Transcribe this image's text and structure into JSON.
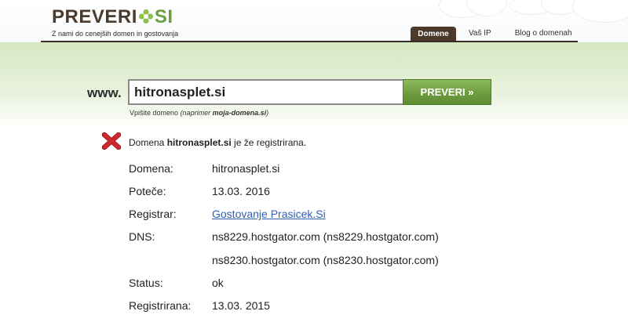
{
  "logo": {
    "prefix": "PREVERI",
    "suffix": "SI",
    "tagline": "Z nami do cenejših domen in gostovanja"
  },
  "nav": {
    "items": [
      {
        "label": "Domene",
        "active": true
      },
      {
        "label": "Vaš IP",
        "active": false
      },
      {
        "label": "Blog o domenah",
        "active": false
      }
    ]
  },
  "search": {
    "prefix": "www.",
    "value": "hitronasplet.si",
    "button_label": "PREVERI »",
    "hint_text": "Vpišite domeno",
    "hint_example_prefix": "(naprimer ",
    "hint_example": "moja-domena.si",
    "hint_example_suffix": ")"
  },
  "result": {
    "icon": "red-x-icon",
    "msg_prefix": "Domena ",
    "msg_domain": "hitronasplet.si",
    "msg_suffix": " je že registrirana.",
    "rows": [
      {
        "label": "Domena:",
        "value": "hitronasplet.si"
      },
      {
        "label": "Poteče:",
        "value": "13.03. 2016"
      },
      {
        "label": "Registrar:",
        "value": "Gostovanje Prasicek.Si"
      },
      {
        "label": "DNS:",
        "value": "ns8229.hostgator.com (ns8229.hostgator.com)"
      },
      {
        "label": "",
        "value": "ns8230.hostgator.com (ns8230.hostgator.com)"
      },
      {
        "label": "Status:",
        "value": "ok"
      },
      {
        "label": "Registrirana:",
        "value": "13.03. 2015"
      }
    ]
  },
  "colors": {
    "brand_brown": "#4a3b2d",
    "brand_green": "#6aa13a",
    "button_green": "#6e9d40",
    "link_blue": "#2f5fb3",
    "error_red": "#d0282e"
  }
}
